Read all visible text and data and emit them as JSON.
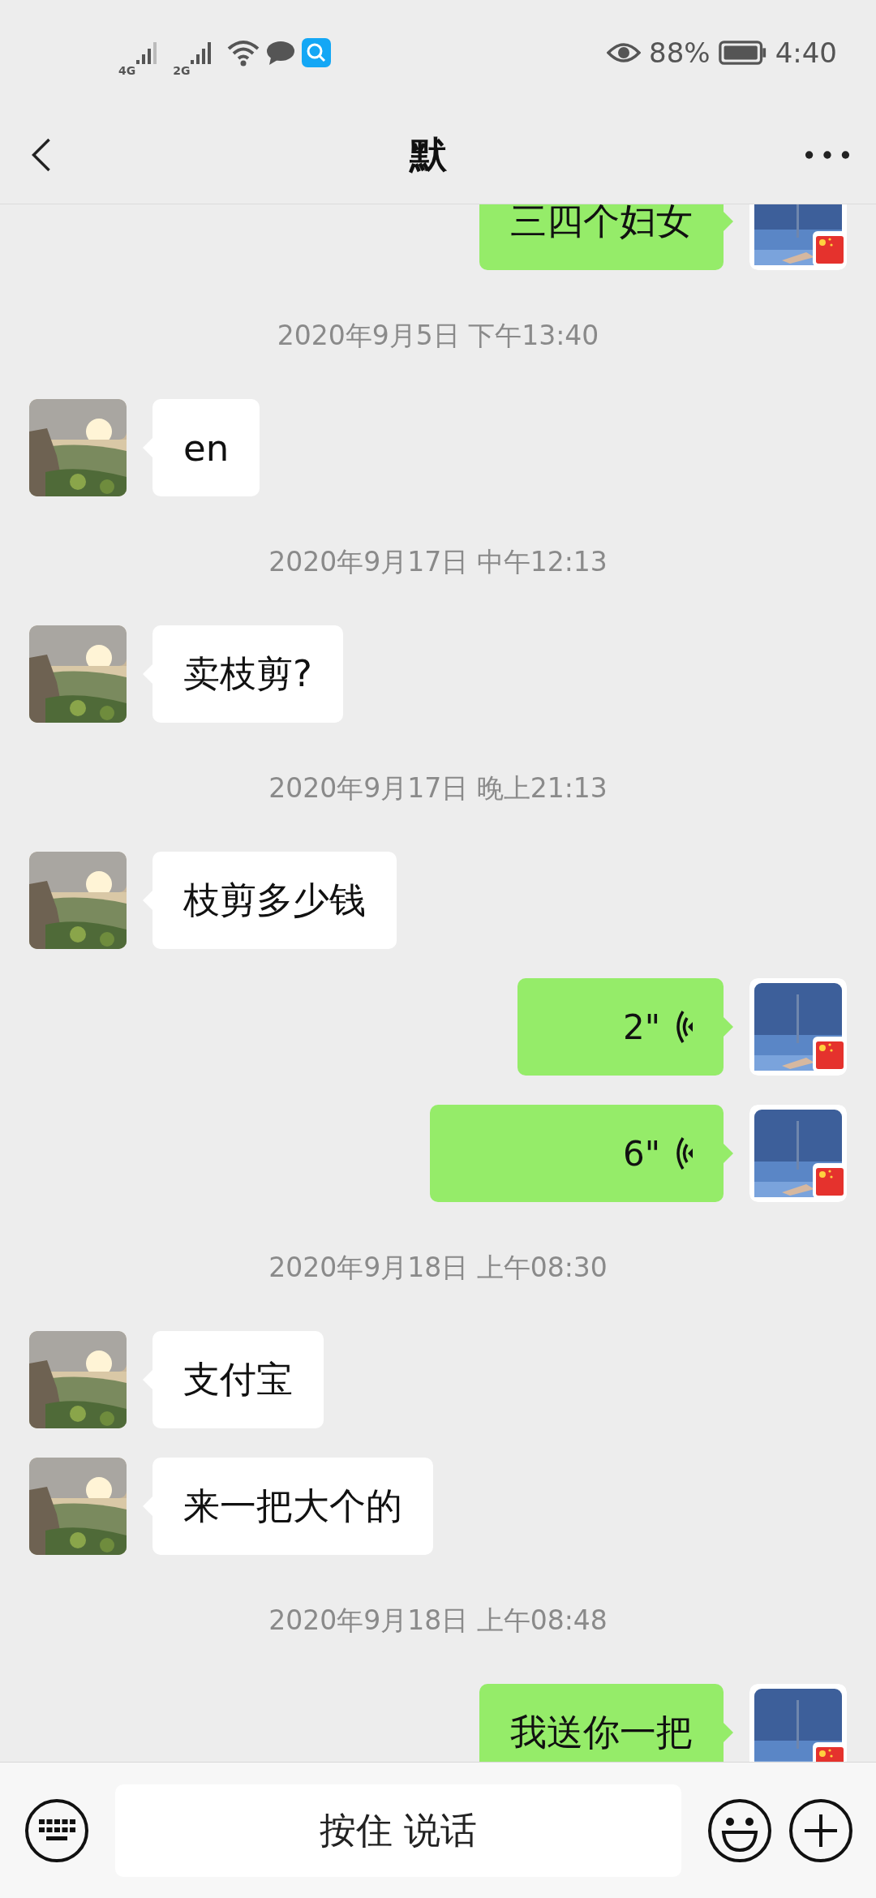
{
  "status_bar": {
    "network_1": "4G",
    "network_2": "2G",
    "battery": "88%",
    "time": "4:40"
  },
  "header": {
    "title": "默"
  },
  "messages": [
    {
      "kind": "sent_text",
      "text": "三四个妇女"
    },
    {
      "kind": "timestamp",
      "text": "2020年9月5日 下午13:40"
    },
    {
      "kind": "received_text",
      "text": "en"
    },
    {
      "kind": "timestamp",
      "text": "2020年9月17日 中午12:13"
    },
    {
      "kind": "received_text",
      "text": "卖枝剪?"
    },
    {
      "kind": "timestamp",
      "text": "2020年9月17日 晚上21:13"
    },
    {
      "kind": "received_text",
      "text": "枝剪多少钱"
    },
    {
      "kind": "sent_voice",
      "duration": "2\""
    },
    {
      "kind": "sent_voice",
      "duration": "6\""
    },
    {
      "kind": "timestamp",
      "text": "2020年9月18日 上午08:30"
    },
    {
      "kind": "received_text",
      "text": "支付宝"
    },
    {
      "kind": "received_text",
      "text": "来一把大个的"
    },
    {
      "kind": "timestamp",
      "text": "2020年9月18日 上午08:48"
    },
    {
      "kind": "sent_text",
      "text": "我送你一把"
    }
  ],
  "input_bar": {
    "hold_to_talk": "按住 说话"
  }
}
